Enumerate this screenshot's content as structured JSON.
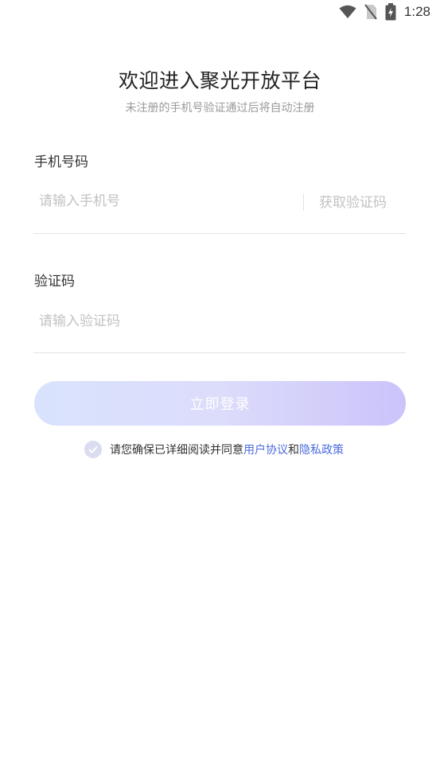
{
  "status_bar": {
    "time": "1:28",
    "icons": [
      "wifi-icon",
      "no-sim-icon",
      "battery-charging-icon"
    ]
  },
  "header": {
    "title": "欢迎进入聚光开放平台",
    "subtitle": "未注册的手机号验证通过后将自动注册"
  },
  "phone": {
    "label": "手机号码",
    "placeholder": "请输入手机号",
    "value": "",
    "get_code_label": "获取验证码"
  },
  "code": {
    "label": "验证码",
    "placeholder": "请输入验证码",
    "value": ""
  },
  "login": {
    "label": "立即登录"
  },
  "agreement": {
    "checked": true,
    "prefix": "请您确保已详细阅读并同意",
    "user_agreement": "用户协议",
    "conjunction": "和",
    "privacy_policy": "隐私政策"
  },
  "colors": {
    "link": "#4b6be0",
    "button_gradient_start": "#d9e3fd",
    "button_gradient_end": "#cbc3fa",
    "placeholder": "#c2c2c2"
  }
}
